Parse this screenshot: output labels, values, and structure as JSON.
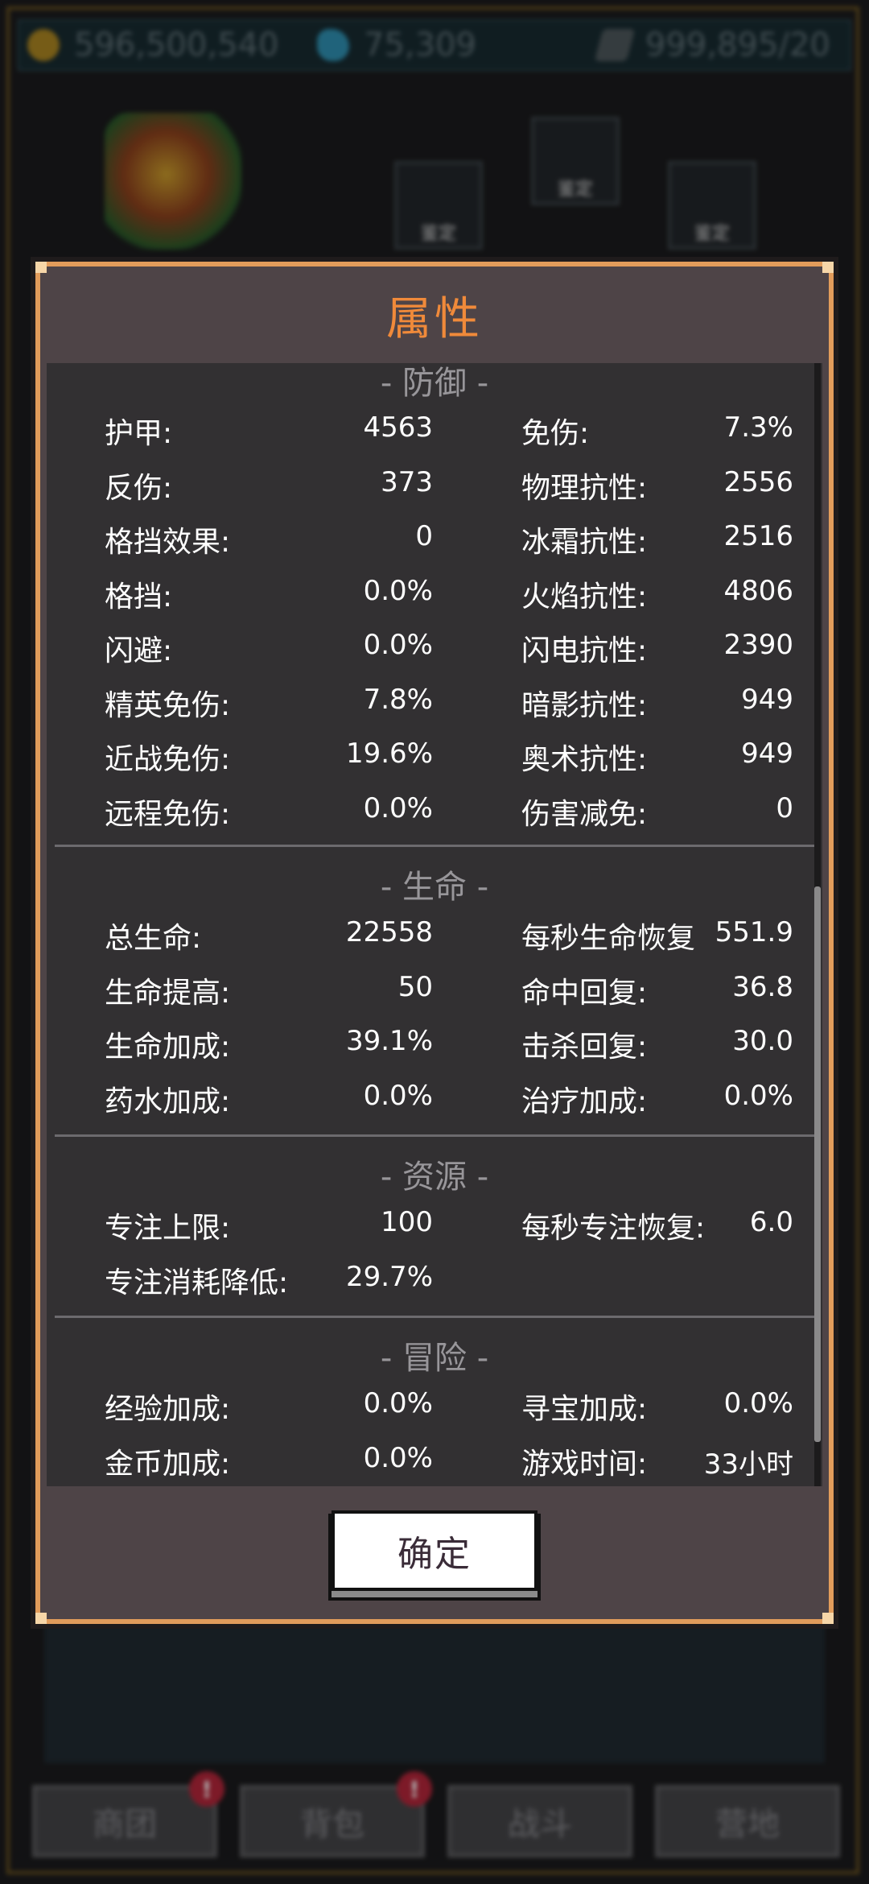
{
  "resources": {
    "gold": "596,500,540",
    "gems": "75,309",
    "energy": "999,895/20"
  },
  "equipment_tag": "鉴定",
  "nav": [
    {
      "label": "商团",
      "badge": "!"
    },
    {
      "label": "背包",
      "badge": "!"
    },
    {
      "label": "战斗",
      "badge": ""
    },
    {
      "label": "营地",
      "badge": ""
    }
  ],
  "dialog": {
    "title": "属性",
    "confirm": "确定",
    "sections": {
      "defense": "- 防御 -",
      "life": "- 生命 -",
      "resource": "- 资源 -",
      "adventure": "- 冒险 -"
    },
    "defense": [
      {
        "l1": "护甲:",
        "v1": "4563",
        "l2": "免伤:",
        "v2": "7.3%"
      },
      {
        "l1": "反伤:",
        "v1": "373",
        "l2": "物理抗性:",
        "v2": "2556"
      },
      {
        "l1": "格挡效果:",
        "v1": "0",
        "l2": "冰霜抗性:",
        "v2": "2516"
      },
      {
        "l1": "格挡:",
        "v1": "0.0%",
        "l2": "火焰抗性:",
        "v2": "4806"
      },
      {
        "l1": "闪避:",
        "v1": "0.0%",
        "l2": "闪电抗性:",
        "v2": "2390"
      },
      {
        "l1": "精英免伤:",
        "v1": "7.8%",
        "l2": "暗影抗性:",
        "v2": "949"
      },
      {
        "l1": "近战免伤:",
        "v1": "19.6%",
        "l2": "奥术抗性:",
        "v2": "949"
      },
      {
        "l1": "远程免伤:",
        "v1": "0.0%",
        "l2": "伤害减免:",
        "v2": "0"
      }
    ],
    "life": [
      {
        "l1": "总生命:",
        "v1": "22558",
        "l2": "每秒生命恢复",
        "v2": "551.9"
      },
      {
        "l1": "生命提高:",
        "v1": "50",
        "l2": "命中回复:",
        "v2": "36.8"
      },
      {
        "l1": "生命加成:",
        "v1": "39.1%",
        "l2": "击杀回复:",
        "v2": "30.0"
      },
      {
        "l1": "药水加成:",
        "v1": "0.0%",
        "l2": "治疗加成:",
        "v2": "0.0%"
      }
    ],
    "resource": [
      {
        "l1": "专注上限:",
        "v1": "100",
        "l2": "每秒专注恢复:",
        "v2": "6.0"
      },
      {
        "l1": "专注消耗降低:",
        "v1": "29.7%",
        "l2": "",
        "v2": ""
      }
    ],
    "adventure": [
      {
        "l1": "经验加成:",
        "v1": "0.0%",
        "l2": "寻宝加成:",
        "v2": "0.0%"
      },
      {
        "l1": "金币加成:",
        "v1": "0.0%",
        "l2": "游戏时间:",
        "v2": "33小时"
      }
    ]
  }
}
